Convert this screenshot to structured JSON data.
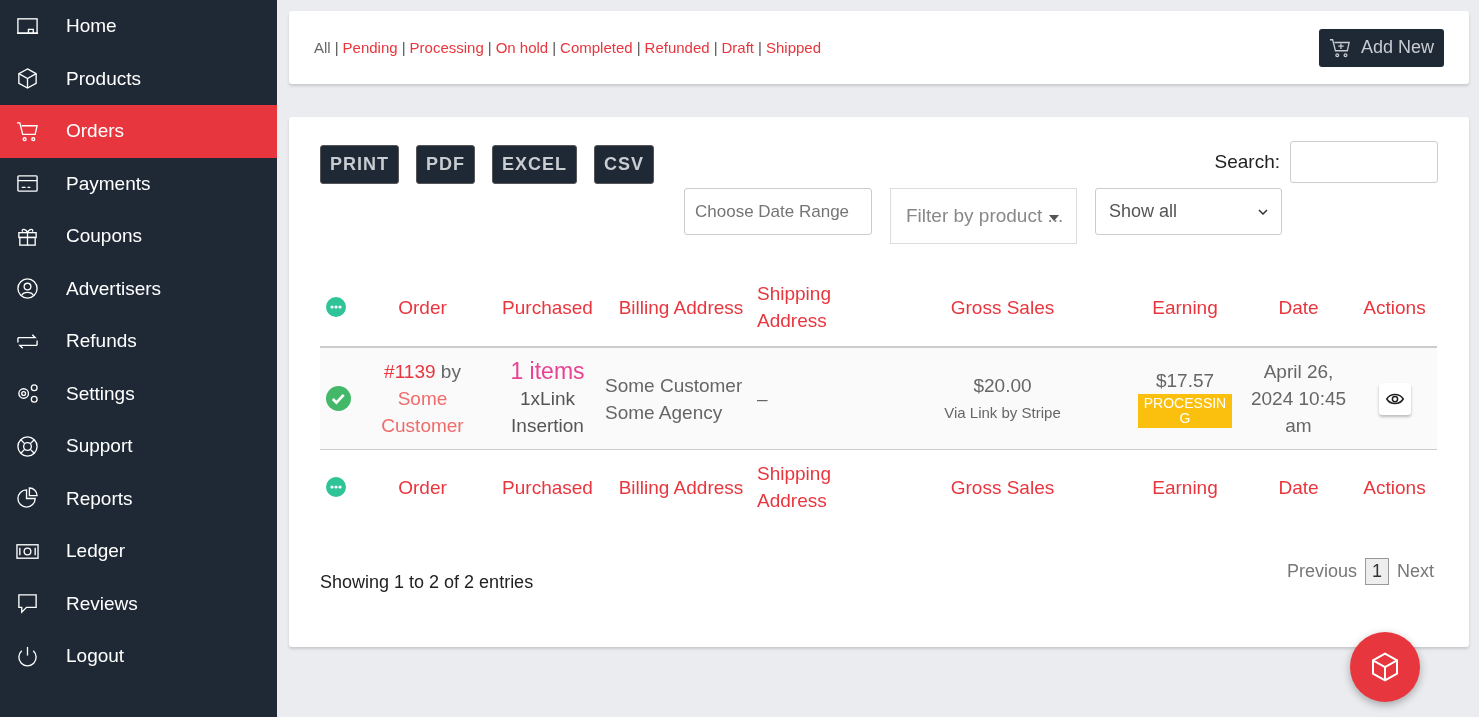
{
  "sidebar": {
    "items": [
      {
        "label": "Home",
        "selected": false
      },
      {
        "label": "Products",
        "selected": false
      },
      {
        "label": "Orders",
        "selected": true
      },
      {
        "label": "Payments",
        "selected": false
      },
      {
        "label": "Coupons",
        "selected": false
      },
      {
        "label": "Advertisers",
        "selected": false
      },
      {
        "label": "Refunds",
        "selected": false
      },
      {
        "label": "Settings",
        "selected": false
      },
      {
        "label": "Support",
        "selected": false
      },
      {
        "label": "Reports",
        "selected": false
      },
      {
        "label": "Ledger",
        "selected": false
      },
      {
        "label": "Reviews",
        "selected": false
      },
      {
        "label": "Logout",
        "selected": false
      }
    ]
  },
  "status_filters": [
    {
      "label": "All",
      "selected": true,
      "separator": "|"
    },
    {
      "label": "Pending",
      "selected": false,
      "separator": "|"
    },
    {
      "label": "Processing",
      "selected": false,
      "separator": "|"
    },
    {
      "label": "On hold",
      "selected": false,
      "separator": "|"
    },
    {
      "label": "Completed",
      "selected": false,
      "separator": "|"
    },
    {
      "label": "Refunded",
      "selected": false,
      "separator": "|"
    },
    {
      "label": "Draft",
      "selected": false,
      "separator": "|"
    },
    {
      "label": "Shipped",
      "selected": false
    }
  ],
  "add_button": "Add New",
  "export_buttons": [
    "PRINT",
    "PDF",
    "EXCEL",
    "CSV"
  ],
  "search": {
    "label": "Search:"
  },
  "filters": {
    "date_range": {
      "placeholder": "Choose Date Range"
    },
    "product": {
      "placeholder": "Filter by product ..."
    },
    "show": {
      "value": "Show all"
    }
  },
  "table": {
    "columns": [
      "Order",
      "Purchased",
      "Billing Address",
      "Shipping Address",
      "Gross Sales",
      "Earning",
      "Date",
      "Actions"
    ],
    "rows": [
      {
        "order": "#1139",
        "by": "by",
        "customer": "Some Customer",
        "items": "1 items",
        "product": "1xLink Insertion",
        "billing": [
          "Some Customer",
          "Some Agency"
        ],
        "shipping": "–",
        "gross": "$20.00",
        "via": "Via Link by Stripe",
        "earning": "$17.57",
        "status": "PROCESSING",
        "date": "April 26, 2024 10:45 am"
      }
    ],
    "footer_columns": [
      "Order",
      "Purchased",
      "Billing Address",
      "Shipping Address",
      "Gross Sales",
      "Earning",
      "Date",
      "Actions"
    ]
  },
  "info": "Showing 1 to 2 of 2 entries",
  "pagination": {
    "previous": "Previous",
    "pages": [
      {
        "label": "1",
        "selected": true
      }
    ],
    "next": "Next"
  }
}
